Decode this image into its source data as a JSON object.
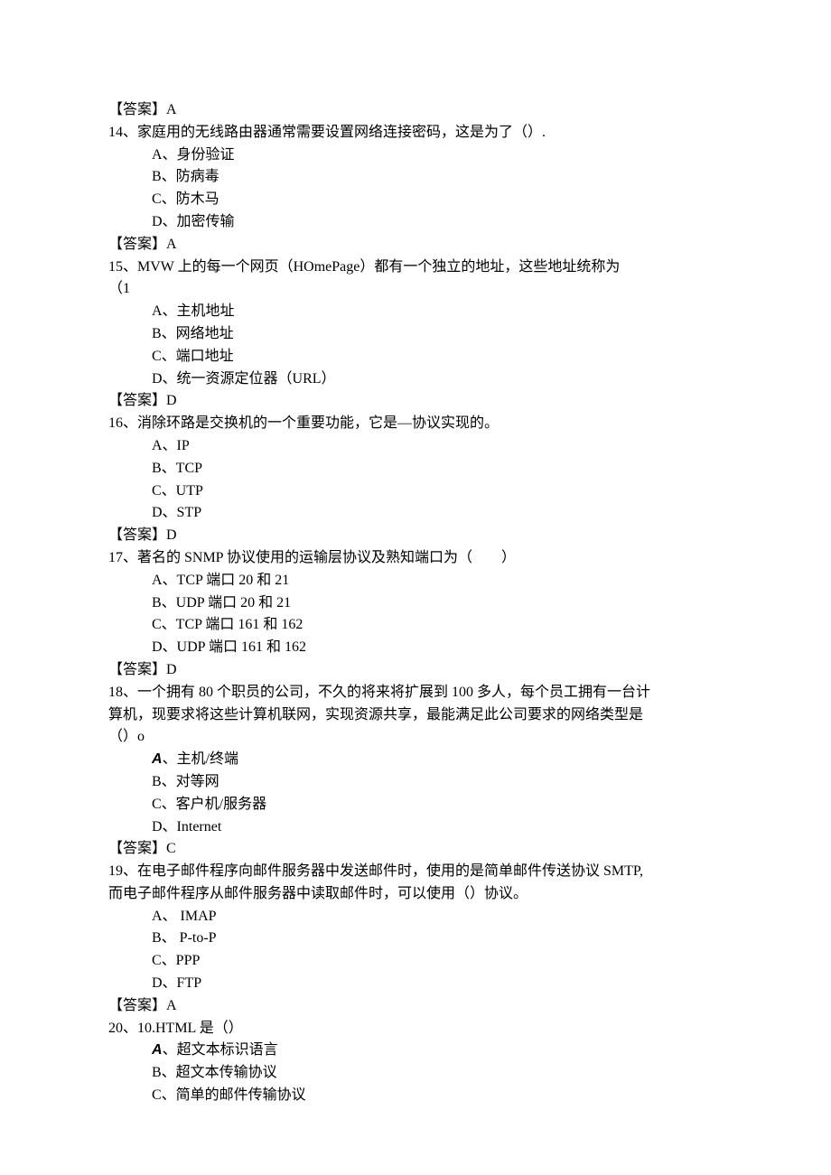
{
  "q13": {
    "ans_label": "【答案】",
    "ans_value": "A"
  },
  "q14": {
    "stem": "14、家庭用的无线路由器通常需要设置网络连接密码，这是为了（）.",
    "opts": [
      "A、身份验证",
      "B、防病毒",
      "C、防木马",
      "D、加密传输"
    ],
    "ans_label": "【答案】",
    "ans_value": "A"
  },
  "q15": {
    "stem1": "15、MVW 上的每一个网页（HOmePage）都有一个独立的地址，这些地址统称为",
    "stem2": "（1",
    "opts": [
      "A、主机地址",
      "B、网络地址",
      "C、端口地址",
      "D、统一资源定位器（URL）"
    ],
    "ans_label": "【答案】",
    "ans_value": "D"
  },
  "q16": {
    "stem": "16、消除环路是交换机的一个重要功能，它是—协议实现的。",
    "opts": [
      "A、IP",
      "B、TCP",
      "C、UTP",
      "D、STP"
    ],
    "ans_label": "【答案】",
    "ans_value": "D"
  },
  "q17": {
    "stem": "17、著名的 SNMP 协议使用的运输层协议及熟知端口为（        ）",
    "opts": [
      "A、TCP 端口 20 和 21",
      "B、UDP 端口 20 和 21",
      "C、TCP 端口 161 和 162",
      "D、UDP 端口 161 和 162"
    ],
    "ans_label": "【答案】",
    "ans_value": "D"
  },
  "q18": {
    "stem1": "18、一个拥有 80 个职员的公司，不久的将来将扩展到 100 多人，每个员工拥有一台计",
    "stem2": "算机，现要求将这些计算机联网，实现资源共享，最能满足此公司要求的网络类型是",
    "stem3": "（）o",
    "optA_prefix": "A",
    "optA_rest": "、主机/终端",
    "opts_rest": [
      "B、对等网",
      "C、客户机/服务器",
      "D、Internet"
    ],
    "ans_label": "【答案】",
    "ans_value": "C"
  },
  "q19": {
    "stem1": "19、在电子邮件程序向邮件服务器中发送邮件时，使用的是简单邮件传送协议 SMTP,",
    "stem2": "而电子邮件程序从邮件服务器中读取邮件时，可以使用（）协议。",
    "opts": [
      "A、 IMAP",
      "B、 P-to-P",
      "C、PPP",
      "D、FTP"
    ],
    "ans_label": "【答案】",
    "ans_value": "A"
  },
  "q20": {
    "stem": "20、10.HTML 是（）",
    "optA_prefix": "A",
    "optA_rest": "、超文本标识语言",
    "opts_rest": [
      "B、超文本传输协议",
      "C、简单的邮件传输协议"
    ]
  }
}
